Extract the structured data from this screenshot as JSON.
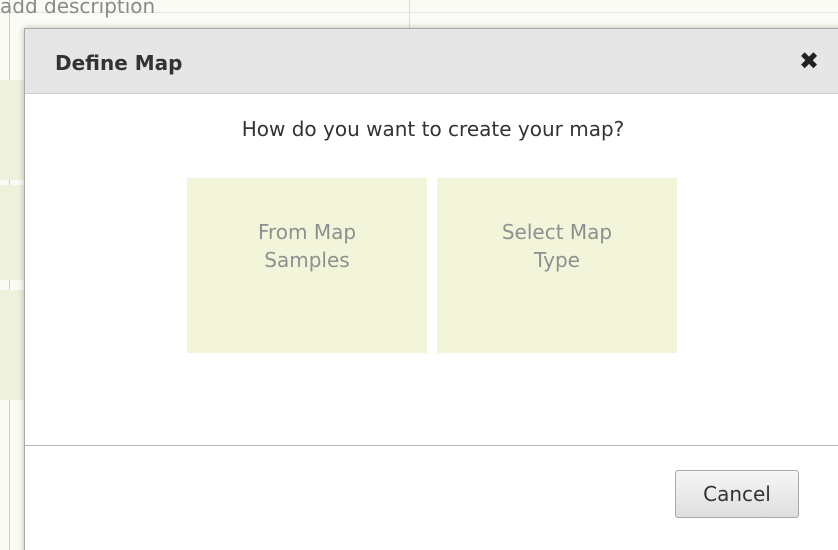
{
  "background": {
    "description_text": "add description"
  },
  "dialog": {
    "title": "Define Map",
    "close_icon": "close-icon",
    "close_glyph": "✖",
    "question": "How do you want to create your map?",
    "options": [
      {
        "label": "From Map Samples"
      },
      {
        "label": "Select Map Type"
      }
    ],
    "cancel_label": "Cancel"
  },
  "colors": {
    "header_bg": "#e6e6e6",
    "tile_bg": "#f2f5da",
    "tile_text": "#8f8f8f",
    "background_strip": "#eef2dc"
  }
}
